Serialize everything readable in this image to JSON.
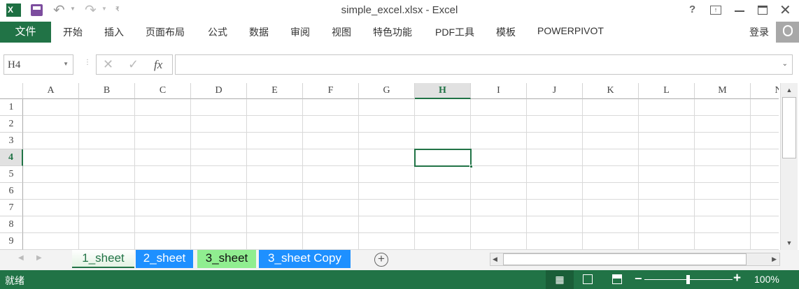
{
  "window": {
    "title": "simple_excel.xlsx - Excel"
  },
  "ribbon": {
    "file": "文件",
    "tabs": [
      "开始",
      "插入",
      "页面布局",
      "公式",
      "数据",
      "审阅",
      "视图",
      "特色功能",
      "PDF工具",
      "模板",
      "POWERPIVOT"
    ],
    "login": "登录"
  },
  "formula_bar": {
    "name_box": "H4",
    "fx": "fx",
    "value": ""
  },
  "grid": {
    "columns": [
      "A",
      "B",
      "C",
      "D",
      "E",
      "F",
      "G",
      "H",
      "I",
      "J",
      "K",
      "L",
      "M",
      "N"
    ],
    "rows": [
      "1",
      "2",
      "3",
      "4",
      "5",
      "6",
      "7",
      "8",
      "9"
    ],
    "selected_cell": "H4"
  },
  "sheets": [
    {
      "label": "1_sheet",
      "color": "#ffffff",
      "active": true
    },
    {
      "label": "2_sheet",
      "color": "#1e90ff"
    },
    {
      "label": "3_sheet",
      "color": "#90ee90"
    },
    {
      "label": "3_sheet Copy",
      "color": "#1e90ff"
    }
  ],
  "status": {
    "text": "就绪",
    "zoom": "100%"
  },
  "colors": {
    "accent": "#217346"
  }
}
